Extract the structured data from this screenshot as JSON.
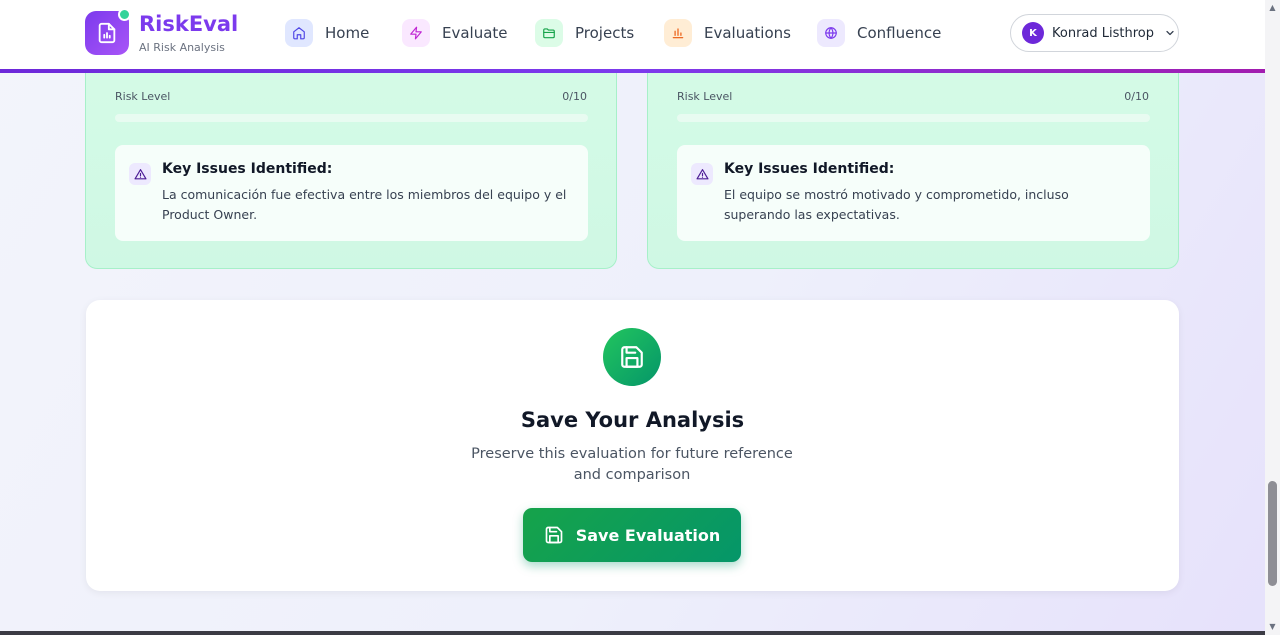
{
  "brand": {
    "title": "RiskEval",
    "subtitle": "AI Risk Analysis"
  },
  "nav": {
    "items": [
      {
        "label": "Home",
        "icon": "home-icon",
        "color": "#e0e7ff",
        "iconColor": "#4f46e5"
      },
      {
        "label": "Evaluate",
        "icon": "bolt-icon",
        "color": "#fae8ff",
        "iconColor": "#c026d3"
      },
      {
        "label": "Projects",
        "icon": "folder-icon",
        "color": "#dcfce7",
        "iconColor": "#16a34a"
      },
      {
        "label": "Evaluations",
        "icon": "bar-chart-icon",
        "color": "#ffedd5",
        "iconColor": "#ea580c"
      },
      {
        "label": "Confluence",
        "icon": "globe-icon",
        "color": "#ede9fe",
        "iconColor": "#7c3aed"
      }
    ]
  },
  "user": {
    "initial": "K",
    "name": "Konrad Listhrop"
  },
  "cards": [
    {
      "risk_label": "Risk Level",
      "risk_score": "0/10",
      "risk_fraction": 0,
      "issues_title": "Key Issues Identified:",
      "issues_text": "La comunicación fue efectiva entre los miembros del equipo y el Product Owner."
    },
    {
      "risk_label": "Risk Level",
      "risk_score": "0/10",
      "risk_fraction": 0,
      "issues_title": "Key Issues Identified:",
      "issues_text": "El equipo se mostró motivado y comprometido, incluso superando las expectativas."
    }
  ],
  "save": {
    "title": "Save Your Analysis",
    "description": "Preserve this evaluation for future reference and comparison",
    "button_label": "Save Evaluation"
  },
  "colors": {
    "brand": "#7c3aed",
    "success": "#059669",
    "card_bg": "#d5fbe7"
  }
}
